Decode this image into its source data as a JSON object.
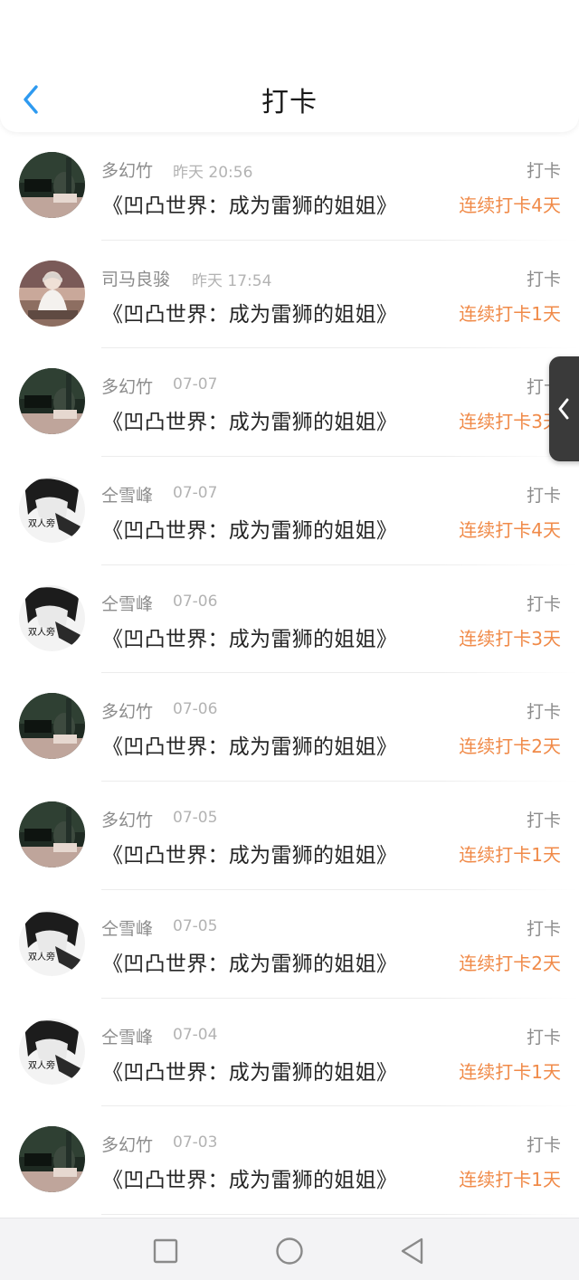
{
  "header": {
    "title": "打卡",
    "back_icon": "chevron-left-icon",
    "accent_color": "#2e9af0"
  },
  "colors": {
    "streak_text": "#f08a48",
    "name_text": "#8c8c8c",
    "time_text": "#b3b3b3",
    "title_text": "#262626"
  },
  "entries": [
    {
      "name": "多幻竹",
      "time": "昨天 20:56",
      "book": "《凹凸世界：成为雷狮的姐姐》",
      "action": "打卡",
      "streak": "连续打卡4天",
      "avatar": "avatar-dark-green"
    },
    {
      "name": "司马良骏",
      "time": "昨天 17:54",
      "book": "《凹凸世界：成为雷狮的姐姐》",
      "action": "打卡",
      "streak": "连续打卡1天",
      "avatar": "avatar-girl-photo"
    },
    {
      "name": "多幻竹",
      "time": "07-07",
      "book": "《凹凸世界：成为雷狮的姐姐》",
      "action": "打卡",
      "streak": "连续打卡3天",
      "avatar": "avatar-dark-green"
    },
    {
      "name": "仝雪峰",
      "time": "07-07",
      "book": "《凹凸世界：成为雷狮的姐姐》",
      "action": "打卡",
      "streak": "连续打卡4天",
      "avatar": "avatar-bw-sketch"
    },
    {
      "name": "仝雪峰",
      "time": "07-06",
      "book": "《凹凸世界：成为雷狮的姐姐》",
      "action": "打卡",
      "streak": "连续打卡3天",
      "avatar": "avatar-bw-sketch"
    },
    {
      "name": "多幻竹",
      "time": "07-06",
      "book": "《凹凸世界：成为雷狮的姐姐》",
      "action": "打卡",
      "streak": "连续打卡2天",
      "avatar": "avatar-dark-green"
    },
    {
      "name": "多幻竹",
      "time": "07-05",
      "book": "《凹凸世界：成为雷狮的姐姐》",
      "action": "打卡",
      "streak": "连续打卡1天",
      "avatar": "avatar-dark-green"
    },
    {
      "name": "仝雪峰",
      "time": "07-05",
      "book": "《凹凸世界：成为雷狮的姐姐》",
      "action": "打卡",
      "streak": "连续打卡2天",
      "avatar": "avatar-bw-sketch"
    },
    {
      "name": "仝雪峰",
      "time": "07-04",
      "book": "《凹凸世界：成为雷狮的姐姐》",
      "action": "打卡",
      "streak": "连续打卡1天",
      "avatar": "avatar-bw-sketch"
    },
    {
      "name": "多幻竹",
      "time": "07-03",
      "book": "《凹凸世界：成为雷狮的姐姐》",
      "action": "打卡",
      "streak": "连续打卡1天",
      "avatar": "avatar-dark-green"
    }
  ],
  "avatar_text": {
    "bw_sketch_caption": "双人旁"
  },
  "side_tab": {
    "icon": "chevron-left-icon"
  },
  "navbar": {
    "recents_icon": "square-icon",
    "home_icon": "circle-icon",
    "back_icon": "triangle-back-icon"
  }
}
